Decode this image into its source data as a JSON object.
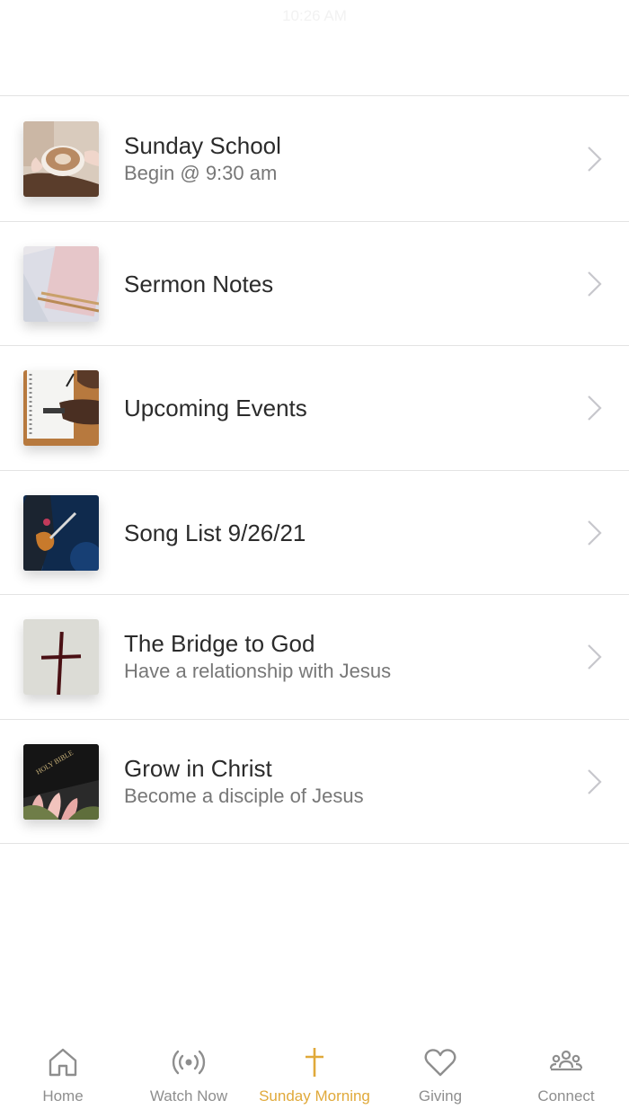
{
  "status_bar": {
    "time": "10:26 AM"
  },
  "items": [
    {
      "title": "Sunday School",
      "subtitle": "Begin @ 9:30 am",
      "image": "coffee-cup-photo"
    },
    {
      "title": "Sermon Notes",
      "subtitle": "",
      "image": "notebook-pencil-photo"
    },
    {
      "title": "Upcoming Events",
      "subtitle": "",
      "image": "writing-notebook-photo"
    },
    {
      "title": "Song List 9/26/21",
      "subtitle": "",
      "image": "guitar-player-photo"
    },
    {
      "title": "The Bridge to God",
      "subtitle": "Have a relationship with Jesus",
      "image": "cross-photo"
    },
    {
      "title": "Grow in Christ",
      "subtitle": "Become a disciple of Jesus",
      "image": "holy-bible-photo"
    }
  ],
  "bible_cover_text": "HOLY BIBLE",
  "tabs": [
    {
      "label": "Home",
      "icon": "home-icon",
      "active": false
    },
    {
      "label": "Watch Now",
      "icon": "broadcast-icon",
      "active": false
    },
    {
      "label": "Sunday Morning",
      "icon": "cross-icon",
      "active": true
    },
    {
      "label": "Giving",
      "icon": "heart-icon",
      "active": false
    },
    {
      "label": "Connect",
      "icon": "people-icon",
      "active": false
    }
  ],
  "colors": {
    "accent": "#e0a93a",
    "inactive": "#8e8e8e",
    "divider": "#e3e3e3"
  }
}
